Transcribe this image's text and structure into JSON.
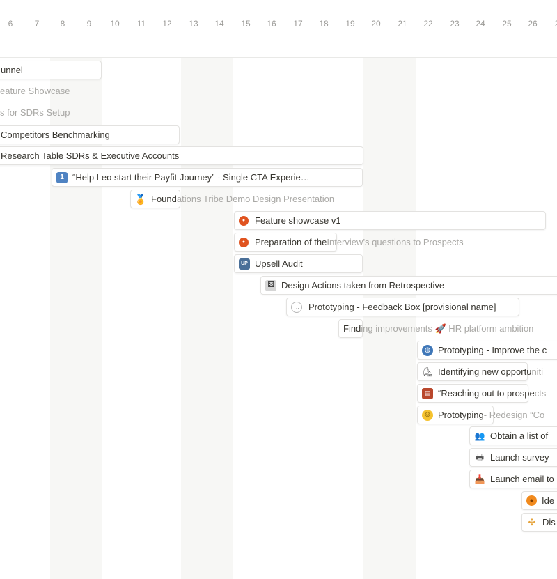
{
  "timeline": {
    "days": [
      "6",
      "7",
      "8",
      "9",
      "10",
      "11",
      "12",
      "13",
      "14",
      "15",
      "16",
      "17",
      "18",
      "19",
      "20",
      "21",
      "22",
      "23",
      "24",
      "25",
      "26",
      "2"
    ]
  },
  "rows": [
    {
      "title": "unnel",
      "overflow": "",
      "icon": ""
    },
    {
      "title": "",
      "overflow": "eature Showcase",
      "icon": ""
    },
    {
      "title": "",
      "overflow": "s for SDRs Setup",
      "icon": ""
    },
    {
      "title": "Competitors Benchmarking",
      "overflow": "",
      "icon": ""
    },
    {
      "title": "Research Table SDRs & Executive Accounts",
      "overflow": "",
      "icon": ""
    },
    {
      "title": "“Help Leo start their Payfit Journey” - Single CTA Experie…",
      "overflow": "",
      "icon": "keycap-1-icon"
    },
    {
      "title": "Found",
      "overflow": "ations Tribe Demo Design Presentation",
      "icon": "medal-icon"
    },
    {
      "title": "Feature showcase v1",
      "overflow": "",
      "icon": "pumpkin-icon"
    },
    {
      "title": "Preparation of the",
      "overflow": " Interview’s questions to Prospects",
      "icon": "pumpkin-icon"
    },
    {
      "title": "Upsell Audit",
      "overflow": "",
      "icon": "up-button-icon"
    },
    {
      "title": "Design Actions taken from Retrospective",
      "overflow": "",
      "icon": "dice-icon"
    },
    {
      "title": "Prototyping - Feedback Box [provisional name]",
      "overflow": "",
      "icon": "speech-bubble-icon"
    },
    {
      "title": "Find",
      "overflow": "ing improvements 🚀 HR platform ambition",
      "icon": ""
    },
    {
      "title": "Prototyping - Improve the c",
      "overflow": "",
      "icon": "globe-icon"
    },
    {
      "title": "Identifying new opportu",
      "overflow": "niti",
      "icon": "skate-icon"
    },
    {
      "title": "“Reaching out to prospe",
      "overflow": "cts",
      "icon": "books-icon"
    },
    {
      "title": "Prototyping",
      "overflow": " - Redesign “Co",
      "icon": "thinking-face-icon"
    },
    {
      "title": "Obtain a list of",
      "overflow": "",
      "icon": "people-icon"
    },
    {
      "title": "Launch survey",
      "overflow": "",
      "icon": "printer-icon"
    },
    {
      "title": "Launch email to",
      "overflow": "",
      "icon": "inbox-icon"
    },
    {
      "title": "Ide",
      "overflow": "",
      "icon": "orange-icon"
    },
    {
      "title": "Dis",
      "overflow": "",
      "icon": "puzzle-icon"
    }
  ]
}
